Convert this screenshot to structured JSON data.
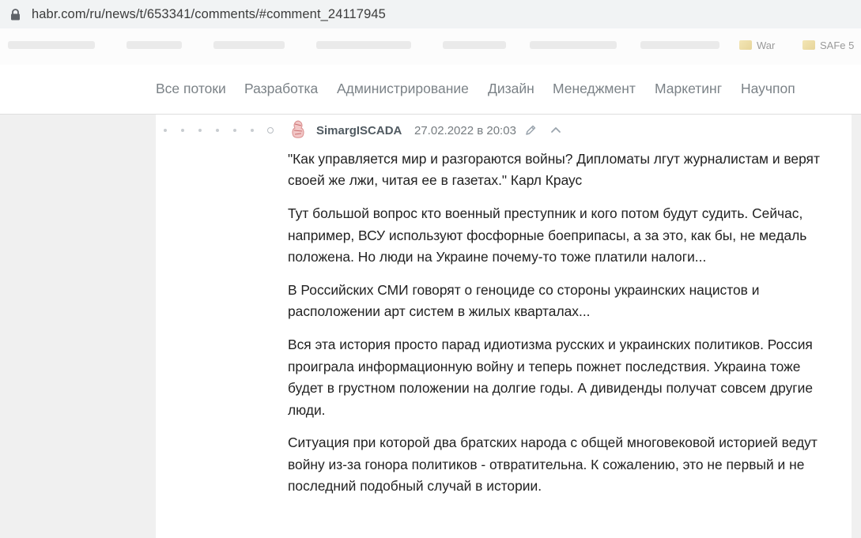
{
  "browser": {
    "url": "habr.com/ru/news/t/653341/comments/#comment_24117945",
    "bookmarks": [
      "War",
      "SAFe 5"
    ]
  },
  "nav": {
    "items": [
      "Все потоки",
      "Разработка",
      "Администрирование",
      "Дизайн",
      "Менеджмент",
      "Маркетинг",
      "Научпоп"
    ]
  },
  "comment": {
    "author": "SimargISCADA",
    "datetime": "27.02.2022 в 20:03",
    "paragraphs": [
      "\"Как управляется мир и разгораются войны? Дипломаты лгут журналистам и верят своей же лжи, читая ее в газетах.\" Карл Краус",
      "Тут большой вопрос кто военный преступник и кого потом будут судить. Сейчас, например, ВСУ используют фосфорные боеприпасы, а за это, как бы, не медаль положена. Но люди на Украине почему-то тоже платили налоги...",
      "В Российских СМИ говорят о геноциде со стороны украинских нацистов и расположении арт систем в жилых кварталах...",
      "Вся эта история просто парад идиотизма русских и украинских политиков. Россия проиграла информационную войну и теперь пожнет последствия. Украина тоже будет в грустном положении на долгие годы. А дивиденды получат совсем другие люди.",
      "Ситуация при которой два братских народа с общей многовековой историей ведут войну из-за гонора политиков - отвратительна. К сожалению, это не первый и не последний подобный случай в истории."
    ]
  },
  "icons": {
    "lock": "lock-icon",
    "edit": "pencil-icon",
    "collapse": "chevron-up-icon",
    "avatar": "avatar-icon"
  },
  "colors": {
    "nav_text": "#7b8287",
    "author": "#505a61",
    "body_text": "#222222",
    "page_bg": "#f0f0f0"
  }
}
